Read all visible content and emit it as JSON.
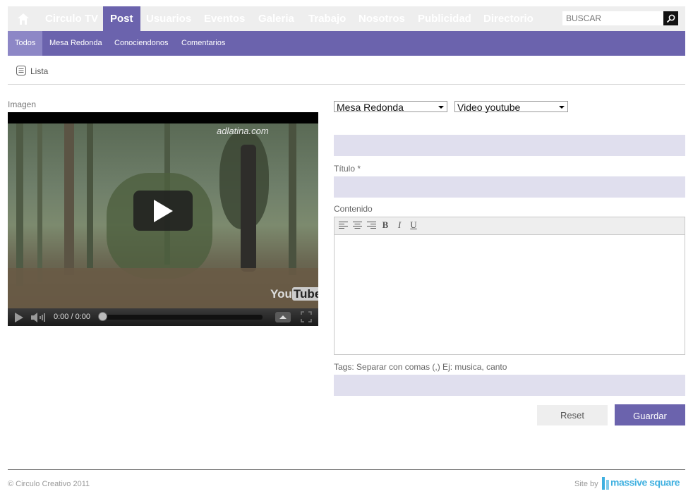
{
  "nav": {
    "items": [
      "Circulo TV",
      "Post",
      "Usuarios",
      "Eventos",
      "Galeria",
      "Trabajo",
      "Nosotros",
      "Publicidad",
      "Directorio"
    ],
    "active": "Post",
    "search_placeholder": "BUSCAR"
  },
  "subnav": {
    "items": [
      "Todos",
      "Mesa Redonda",
      "Conociendonos",
      "Comentarios"
    ],
    "active": "Todos"
  },
  "view": {
    "lista_label": "Lista"
  },
  "left": {
    "imagen_label": "Imagen",
    "video": {
      "watermark": "adlatina.com",
      "time": "0:00 / 0:00",
      "logo_you": "You",
      "logo_tube": "Tube"
    }
  },
  "form": {
    "category_select": "Mesa Redonda",
    "type_select": "Video youtube",
    "titulo_label": "Título *",
    "contenido_label": "Contenido",
    "editor_tools": [
      "align-left-icon",
      "align-center-icon",
      "align-right-icon",
      "bold-icon",
      "italic-icon",
      "underline-icon"
    ],
    "bold_glyph": "B",
    "italic_glyph": "I",
    "underline_glyph": "U",
    "tags_label": "Tags: Separar con comas (,) Ej: musica, canto",
    "reset_label": "Reset",
    "guardar_label": "Guardar"
  },
  "footer": {
    "copyright": "© Circulo Creativo 2011",
    "site_by": "Site by",
    "brand": "massive square"
  },
  "colors": {
    "accent": "#6b63ad",
    "accent_light": "#8d87c6",
    "field_bg": "#e0dfee",
    "brand_blue": "#3fb0e0"
  }
}
